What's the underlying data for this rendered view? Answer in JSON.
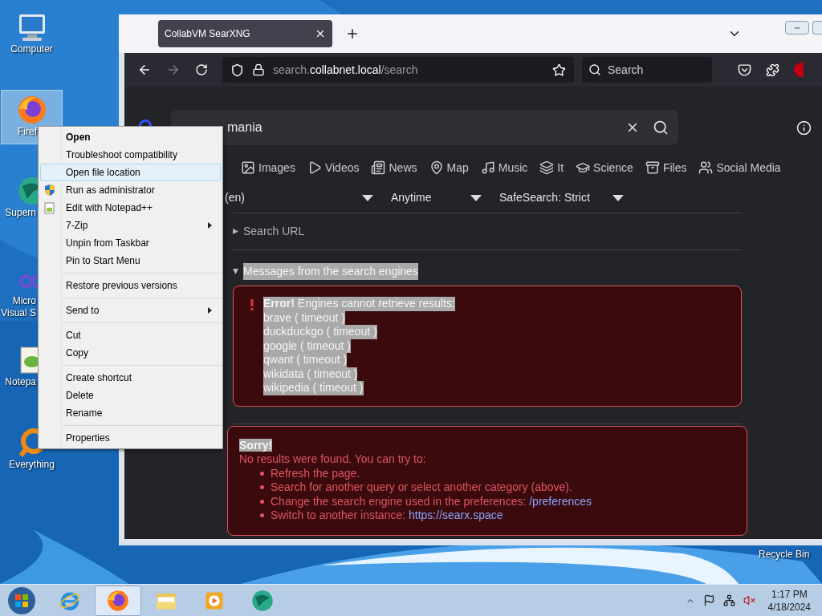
{
  "desktop": {
    "icons": [
      {
        "kind": "computer",
        "label": "Computer",
        "selected": false
      },
      {
        "kind": "firefox",
        "label": "Firef",
        "selected": true
      },
      {
        "kind": "globe",
        "label": "Supern",
        "selected": false
      },
      {
        "kind": "infinity",
        "label": "Micro\nVisual S",
        "selected": false
      },
      {
        "kind": "notepad",
        "label": "Notepa",
        "selected": false
      },
      {
        "kind": "ring",
        "label": "Everything",
        "selected": false
      }
    ],
    "recycle_bin": "Recycle Bin"
  },
  "context_menu": {
    "groups": [
      [
        {
          "label": "Open",
          "default": true,
          "hovered": false,
          "submenu": false
        },
        {
          "label": "Troubleshoot compatibility",
          "default": false,
          "hovered": false,
          "submenu": false
        },
        {
          "label": "Open file location",
          "default": false,
          "hovered": true,
          "submenu": false
        },
        {
          "label": "Run as administrator",
          "default": false,
          "hovered": false,
          "submenu": false,
          "kind": "shield"
        },
        {
          "label": "Edit with Notepad++",
          "default": false,
          "hovered": false,
          "submenu": false,
          "kind": "notepad"
        },
        {
          "label": "7-Zip",
          "default": false,
          "hovered": false,
          "submenu": true
        },
        {
          "label": "Unpin from Taskbar",
          "default": false,
          "hovered": false,
          "submenu": false
        },
        {
          "label": "Pin to Start Menu",
          "default": false,
          "hovered": false,
          "submenu": false
        }
      ],
      [
        {
          "label": "Restore previous versions",
          "default": false,
          "hovered": false,
          "submenu": false
        }
      ],
      [
        {
          "label": "Send to",
          "default": false,
          "hovered": false,
          "submenu": true
        }
      ],
      [
        {
          "label": "Cut",
          "default": false,
          "hovered": false,
          "submenu": false
        },
        {
          "label": "Copy",
          "default": false,
          "hovered": false,
          "submenu": false
        }
      ],
      [
        {
          "label": "Create shortcut",
          "default": false,
          "hovered": false,
          "submenu": false
        },
        {
          "label": "Delete",
          "default": false,
          "hovered": false,
          "submenu": false
        },
        {
          "label": "Rename",
          "default": false,
          "hovered": false,
          "submenu": false
        }
      ],
      [
        {
          "label": "Properties",
          "default": false,
          "hovered": false,
          "submenu": false
        }
      ]
    ]
  },
  "browser": {
    "tabs": [
      {
        "title": "CollabVM SearXNG",
        "selected": true
      }
    ],
    "address": {
      "prefix": "search.",
      "host": "collabnet.local",
      "path": "/search"
    },
    "search_placeholder": "Search",
    "page": {
      "query": "mania",
      "categories": [
        {
          "kind": "images",
          "label": "Images"
        },
        {
          "kind": "videos",
          "label": "Videos"
        },
        {
          "kind": "news",
          "label": "News"
        },
        {
          "kind": "map",
          "label": "Map"
        },
        {
          "kind": "music",
          "label": "Music"
        },
        {
          "kind": "it",
          "label": "It"
        },
        {
          "kind": "science",
          "label": "Science"
        },
        {
          "kind": "files",
          "label": "Files"
        },
        {
          "kind": "social",
          "label": "Social Media"
        }
      ],
      "filters": [
        "(en)",
        "Anytime",
        "SafeSearch: Strict"
      ],
      "search_url": {
        "label": "Search URL",
        "expanded": false
      },
      "messages": {
        "label": "Messages from the search engines",
        "expanded": true,
        "highlighted": true,
        "error": "**Error!** Engines cannot retrieve results:",
        "engines": [
          "brave ( timeout )",
          "duckduckgo ( timeout )",
          "google ( timeout )",
          "qwant ( timeout )",
          "wikidata ( timeout )",
          "wikipedia ( timeout )"
        ]
      },
      "sorry": {
        "title": "Sorry!",
        "text": "No results were found. You can try to:",
        "suggestions": [
          {
            "text": "Refresh the page."
          },
          {
            "text": "Search for another query or select another category (above)."
          },
          {
            "text": "Change the search engine used in the preferences:",
            "link": "/preferences"
          },
          {
            "text": "Switch to another instance:",
            "link": "https://searx.space"
          }
        ]
      }
    }
  },
  "taskbar": {
    "apps": [
      {
        "kind": "ie",
        "selected": false
      },
      {
        "kind": "firefox",
        "selected": true
      },
      {
        "kind": "folder",
        "selected": false
      },
      {
        "kind": "media",
        "selected": false
      },
      {
        "kind": "globe",
        "selected": false
      }
    ],
    "time": "1:17 PM",
    "date": "4/18/2024"
  }
}
